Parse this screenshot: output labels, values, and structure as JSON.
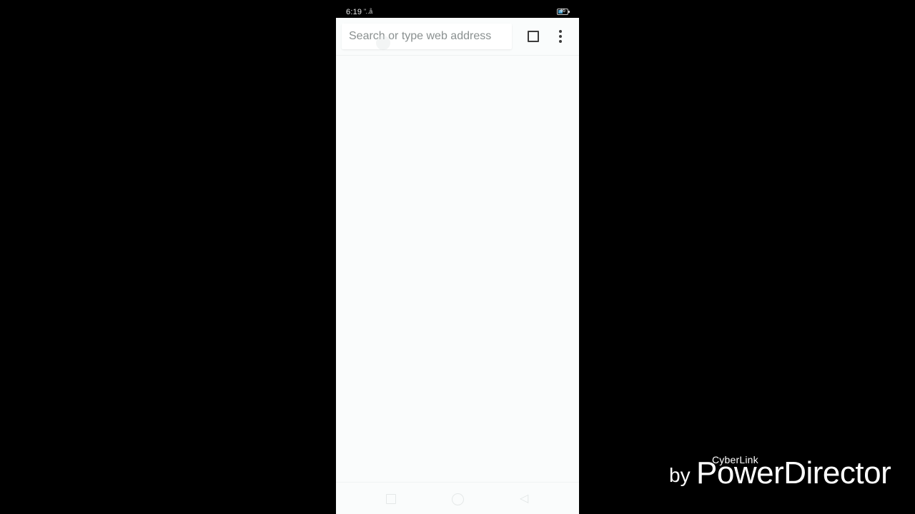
{
  "status_bar": {
    "time": "6:19",
    "signal_glyph": "\"‥å",
    "battery_text": "46",
    "battery_level_percent": 46,
    "battery_color": "#4a9ec9"
  },
  "browser": {
    "omnibox": {
      "value": "",
      "placeholder": "Search or type web address"
    },
    "icons": {
      "tab_switcher": "square-outline-icon",
      "menu": "vertical-ellipsis-icon"
    },
    "colors": {
      "toolbar_bg": "#fafcfc",
      "icon": "#3c3c3c"
    }
  },
  "nav_bar": {
    "icons": [
      "square-icon",
      "circle-icon",
      "triangle-back-icon"
    ],
    "back_glyph": "◁"
  },
  "watermark": {
    "brand": "CyberLink",
    "by": "by",
    "product": "PowerDirector"
  }
}
